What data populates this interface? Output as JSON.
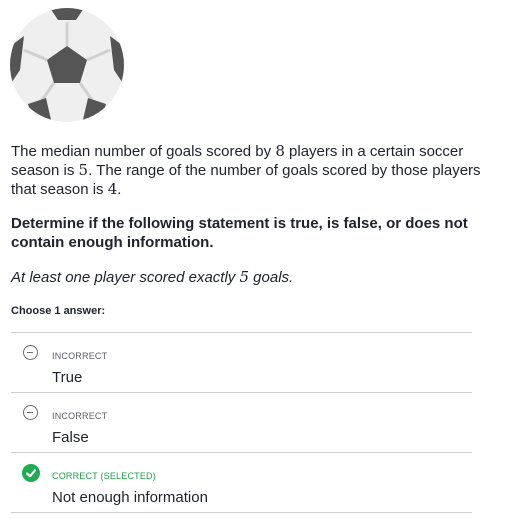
{
  "question": {
    "part1": "The median number of goals scored by ",
    "players_count": "8",
    "part2": " players in a certain soccer season is ",
    "median": "5",
    "part3": ". The range of the number of goals scored by those players that season is ",
    "range": "4",
    "part4": "."
  },
  "instruction": "Determine if the following statement is true, is false, or does not contain enough information.",
  "statement": {
    "part1": "At least one player scored exactly ",
    "num": "5",
    "part2": " goals."
  },
  "choose_label": "Choose 1 answer:",
  "options": [
    {
      "status": "INCORRECT",
      "label": "True",
      "icon": "minus-circle-icon"
    },
    {
      "status": "INCORRECT",
      "label": "False",
      "icon": "minus-circle-icon"
    },
    {
      "status": "CORRECT (SELECTED)",
      "label": "Not enough information",
      "icon": "check-circle-icon"
    }
  ],
  "colors": {
    "correct": "#1fab54",
    "text": "#21242c",
    "muted": "#5b5e66"
  }
}
